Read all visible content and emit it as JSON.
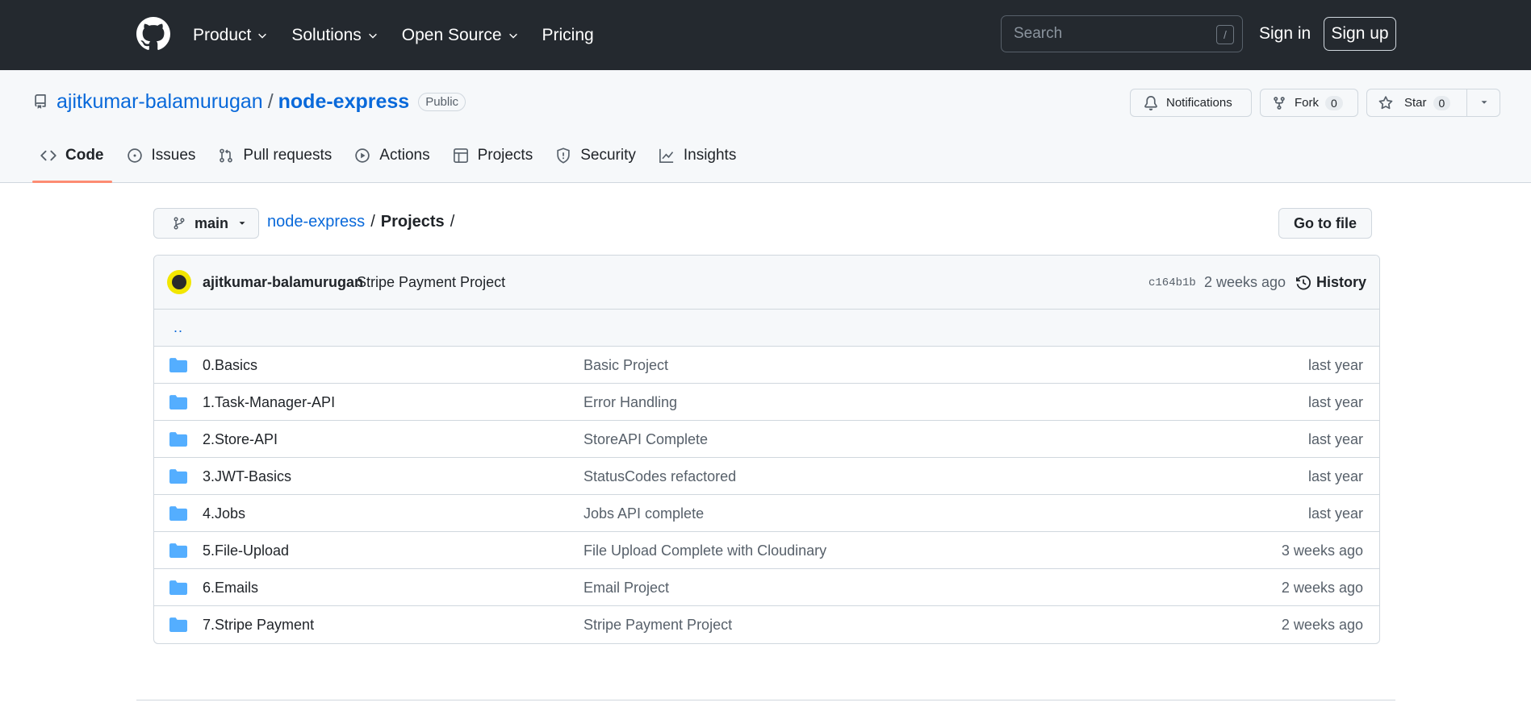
{
  "header": {
    "nav": [
      {
        "label": "Product",
        "has_caret": true
      },
      {
        "label": "Solutions",
        "has_caret": true
      },
      {
        "label": "Open Source",
        "has_caret": true
      },
      {
        "label": "Pricing",
        "has_caret": false
      }
    ],
    "search_placeholder": "Search",
    "search_shortcut": "/",
    "signin_label": "Sign in",
    "signup_label": "Sign up"
  },
  "repo": {
    "owner": "ajitkumar-balamurugan",
    "separator": "/",
    "name": "node-express",
    "visibility": "Public",
    "notifications_label": "Notifications",
    "fork_label": "Fork",
    "fork_count": "0",
    "star_label": "Star",
    "star_count": "0"
  },
  "tabs": [
    {
      "label": "Code",
      "icon": "code-icon",
      "active": true
    },
    {
      "label": "Issues",
      "icon": "issue-icon",
      "active": false
    },
    {
      "label": "Pull requests",
      "icon": "pull-request-icon",
      "active": false
    },
    {
      "label": "Actions",
      "icon": "play-icon",
      "active": false
    },
    {
      "label": "Projects",
      "icon": "table-icon",
      "active": false
    },
    {
      "label": "Security",
      "icon": "shield-icon",
      "active": false
    },
    {
      "label": "Insights",
      "icon": "graph-icon",
      "active": false
    }
  ],
  "toolbar": {
    "branch": "main",
    "breadcrumb_root": "node-express",
    "breadcrumb_sep": "/",
    "breadcrumb_current": "Projects",
    "breadcrumb_trailing": "/",
    "goto_file_label": "Go to file"
  },
  "latest_commit": {
    "author": "ajitkumar-balamurugan",
    "message": "Stripe Payment Project",
    "sha": "c164b1b",
    "time": "2 weeks ago",
    "history_label": "History"
  },
  "parent_dir": "..",
  "files": [
    {
      "name": "0.Basics",
      "message": "Basic Project",
      "time": "last year"
    },
    {
      "name": "1.Task-Manager-API",
      "message": "Error Handling",
      "time": "last year"
    },
    {
      "name": "2.Store-API",
      "message": "StoreAPI Complete",
      "time": "last year"
    },
    {
      "name": "3.JWT-Basics",
      "message": "StatusCodes refactored",
      "time": "last year"
    },
    {
      "name": "4.Jobs",
      "message": "Jobs API complete",
      "time": "last year"
    },
    {
      "name": "5.File-Upload",
      "message": "File Upload Complete with Cloudinary",
      "time": "3 weeks ago"
    },
    {
      "name": "6.Emails",
      "message": "Email Project",
      "time": "2 weeks ago"
    },
    {
      "name": "7.Stripe Payment",
      "message": "Stripe Payment Project",
      "time": "2 weeks ago"
    }
  ],
  "colors": {
    "header_bg": "#24292f",
    "link": "#0969da",
    "active_tab_underline": "#fd8c73",
    "folder": "#54aeff"
  }
}
